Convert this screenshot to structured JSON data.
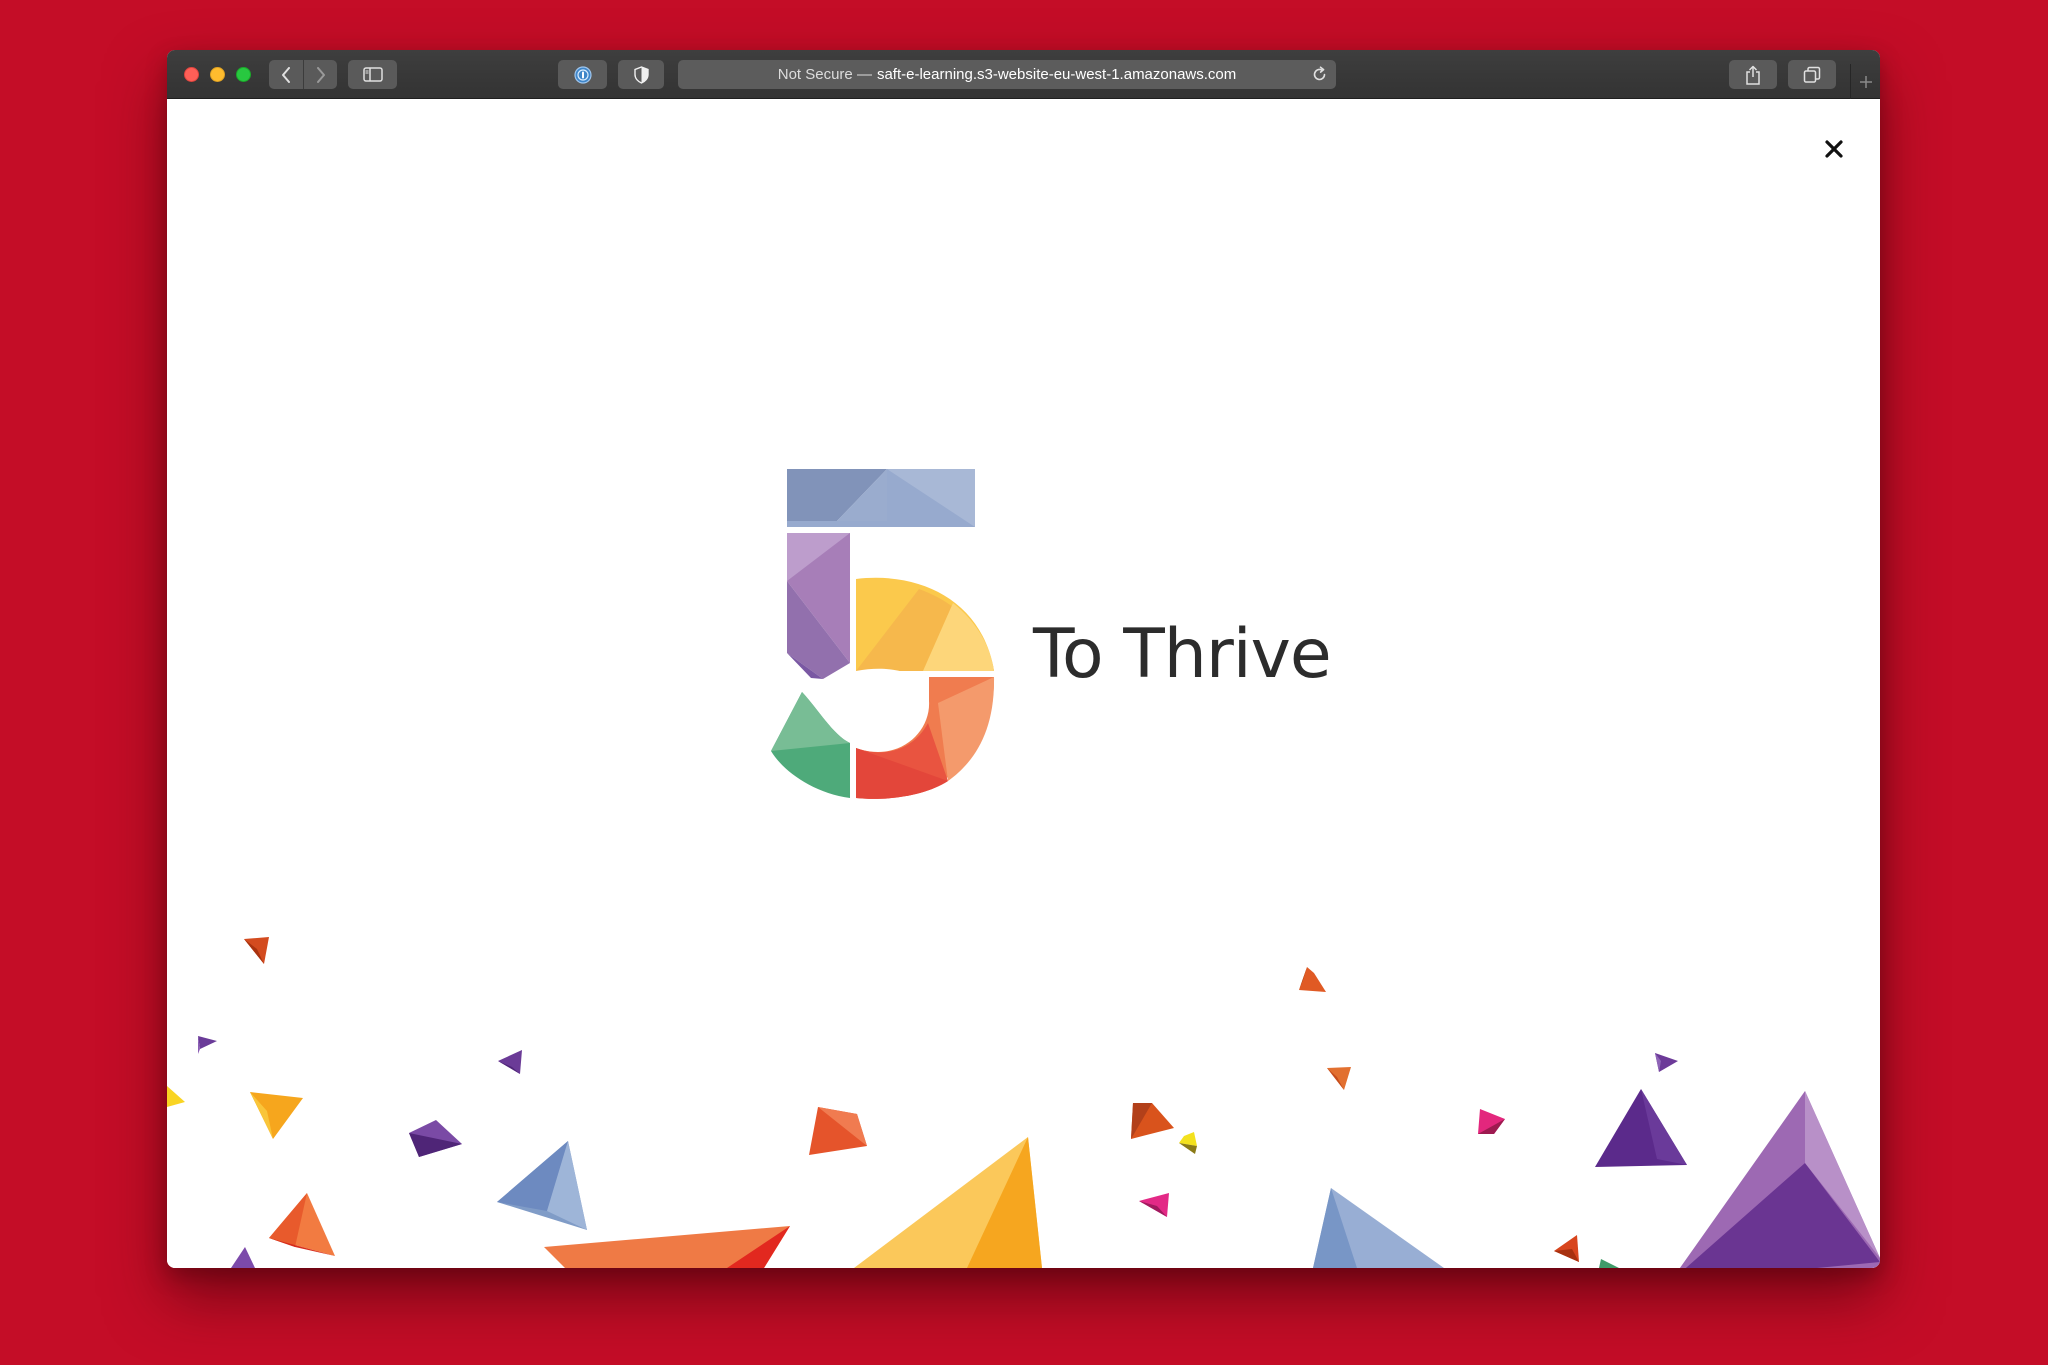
{
  "browser": {
    "url_prefix": "Not Secure —",
    "url_domain": "saft-e-learning.s3-website-eu-west-1.amazonaws.com",
    "icons": {
      "back": "chevron-left-icon",
      "forward": "chevron-right-icon",
      "sidebar": "sidebar-icon",
      "password": "password-manager-icon",
      "privacy": "shield-icon",
      "reload": "reload-icon",
      "share": "share-icon",
      "tabs": "tabs-overview-icon",
      "new_tab": "plus-icon"
    }
  },
  "page": {
    "logo_numeral": "5",
    "logo_text": "To Thrive",
    "close_icon": "close-icon"
  },
  "colors": {
    "background": "#c40d27",
    "text": "#2c2c2c",
    "blue": "#8ea3c6",
    "purple": "#a97fba",
    "yellow": "#fbc74e",
    "orange": "#f07f50",
    "red": "#e7533f",
    "green": "#4fae7d"
  }
}
